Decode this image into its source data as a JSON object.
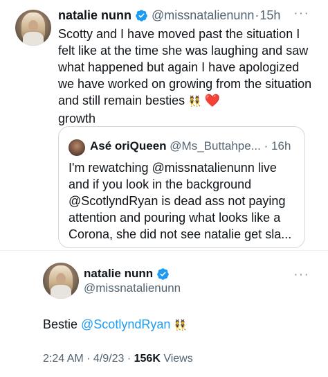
{
  "quoted_tweet": {
    "author_name": "natalie nunn",
    "handle": "@missnatalienunn",
    "separator": "·",
    "time": "15h",
    "more": "···",
    "text_main": "Scotty and I have moved past the situation I felt like at the time she was laughing and saw what happened but again I have apologized we have worked on growing from the situation and still remain besties ",
    "emoji_dancers": "👯",
    "emoji_heart": "❤️",
    "text_end": "growth",
    "quote": {
      "author_name": "Asé oriQueen",
      "handle": "@Ms_Buttahpe...",
      "separator": "·",
      "time": "16h",
      "text": "I'm rewatching @missnatalienunn live and if you look in the background @ScotlyndRyan is dead ass not paying attention and pouring what looks like a Corona, she did not see natalie get sla..."
    }
  },
  "main_tweet": {
    "author_name": "natalie nunn",
    "handle": "@missnatalienunn",
    "more": "···",
    "text_prefix": "Bestie ",
    "mention": "@ScotlyndRyan",
    "emoji_dancers": "👯",
    "timestamp": "2:24 AM · 4/9/23 · ",
    "views_count": "156K",
    "views_label": " Views"
  },
  "colors": {
    "verified": "#1d9bf0",
    "link": "#1d9bf0",
    "muted": "#536471"
  },
  "icons": [
    "verified-badge-icon",
    "more-options-icon"
  ]
}
